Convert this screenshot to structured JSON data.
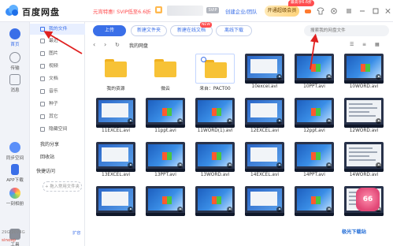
{
  "app": {
    "brand": "百度网盘",
    "promo": "元宵特惠! SVIP低至6.6折",
    "svip_tag": "SVIP",
    "enterprise": "创建企业/团队",
    "svip_button": "开通超级会员",
    "hot_badge": "最高享6.6折"
  },
  "rail": [
    {
      "label": "首页",
      "icon": "home-icon",
      "color": "#3a6fe8"
    },
    {
      "label": "传输",
      "icon": "transfer-icon",
      "color": "#8a8f99"
    },
    {
      "label": "消息",
      "icon": "message-icon",
      "color": "#8a8f99"
    },
    {
      "label": "同步空间",
      "icon": "sync-icon",
      "color": "#3a6fe8"
    },
    {
      "label": "APP下载",
      "icon": "phone-icon",
      "color": "#3a6fe8"
    },
    {
      "label": "一刻相册",
      "icon": "album-icon",
      "color": "#3a6fe8"
    },
    {
      "label": "工具",
      "icon": "tools-icon",
      "color": "#8a8f99"
    }
  ],
  "sidebar": {
    "items": [
      {
        "label": "我的文件",
        "active": true
      },
      {
        "label": "最近"
      },
      {
        "label": "图片"
      },
      {
        "label": "视频"
      },
      {
        "label": "文档"
      },
      {
        "label": "音乐"
      },
      {
        "label": "种子"
      },
      {
        "label": "其它"
      },
      {
        "label": "隐藏空间"
      }
    ],
    "share": "我的分享",
    "recycle": "回收站",
    "quick": "快捷访问",
    "add_quick": "+ 拖入常用文件夹",
    "storage": "29G/2074G",
    "storage_fraction": 0.014,
    "expand": "扩容"
  },
  "toolbar": {
    "upload": "上传",
    "new_folder": "新建文件夹",
    "new_online_doc": "新建在线文档",
    "offline_download": "离线下载",
    "new_tag": "NEW",
    "search_placeholder": "搜索我的网盘文件"
  },
  "breadcrumb": "我的网盘",
  "files": [
    {
      "name": "我的资源",
      "kind": "folder"
    },
    {
      "name": "微云",
      "kind": "folder"
    },
    {
      "name": "来自：PACT00",
      "kind": "folder",
      "selected": true
    },
    {
      "name": "10excel.avi",
      "kind": "desktop"
    },
    {
      "name": "10PPT.avi",
      "kind": "win"
    },
    {
      "name": "10WORD.avi",
      "kind": "win"
    },
    {
      "name": "11EXCEL.avi",
      "kind": "desktop"
    },
    {
      "name": "11ppt.avi",
      "kind": "win"
    },
    {
      "name": "11WORD(1).avi",
      "kind": "win"
    },
    {
      "name": "12EXCEL.avi",
      "kind": "desktop"
    },
    {
      "name": "12ppt.avi",
      "kind": "win"
    },
    {
      "name": "12WORD.avi",
      "kind": "panel"
    },
    {
      "name": "13EXCEL.avi",
      "kind": "desktop"
    },
    {
      "name": "13PPT.avi",
      "kind": "win"
    },
    {
      "name": "13WORD.avi",
      "kind": "win"
    },
    {
      "name": "14EXCEL.avi",
      "kind": "desktop"
    },
    {
      "name": "14PPT.avi",
      "kind": "win"
    },
    {
      "name": "14WORD.avi",
      "kind": "panel"
    },
    {
      "name": "",
      "kind": "desktop"
    },
    {
      "name": "",
      "kind": "win"
    },
    {
      "name": "",
      "kind": "win"
    },
    {
      "name": "",
      "kind": "desktop"
    },
    {
      "name": "",
      "kind": "win"
    },
    {
      "name": "",
      "kind": "panel"
    }
  ],
  "pet_badge": "66",
  "watermark": "极光下载站",
  "footer_text": "sinosp"
}
